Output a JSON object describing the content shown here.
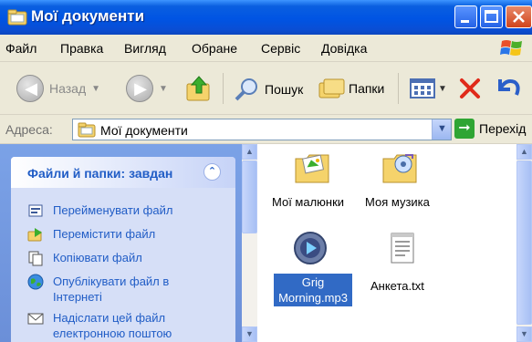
{
  "window": {
    "title": "Мої документи"
  },
  "menu": [
    "Файл",
    "Правка",
    "Вигляд",
    "Обране",
    "Сервіс",
    "Довідка"
  ],
  "toolbar": {
    "back_label": "Назад",
    "search_label": "Пошук",
    "folders_label": "Папки"
  },
  "address": {
    "label": "Адреса:",
    "value": "Мої документи",
    "go_label": "Перехід"
  },
  "task_pane": {
    "title": "Файли й папки: завдан",
    "tasks": [
      {
        "line1": "Перейменувати файл",
        "line2": ""
      },
      {
        "line1": "Перемістити файл",
        "line2": ""
      },
      {
        "line1": "Копіювати файл",
        "line2": ""
      },
      {
        "line1": "Опублікувати файл в",
        "line2": "Інтернеті"
      },
      {
        "line1": "Надіслати цей файл",
        "line2": "електронною поштою"
      }
    ]
  },
  "files": [
    {
      "name": "Мої малюнки",
      "icon": "pictures-folder-icon"
    },
    {
      "name": "Моя музика",
      "icon": "music-folder-icon"
    },
    {
      "name_line1": "Grig",
      "name_line2": "Morning.mp3",
      "icon": "media-file-icon",
      "selected": true
    },
    {
      "name": "Анкета.txt",
      "icon": "text-file-icon"
    }
  ],
  "colors": {
    "titlebar": "#0054e3",
    "taskpane": "#6b8fd8",
    "link": "#215dc6",
    "selection": "#316ac5"
  }
}
